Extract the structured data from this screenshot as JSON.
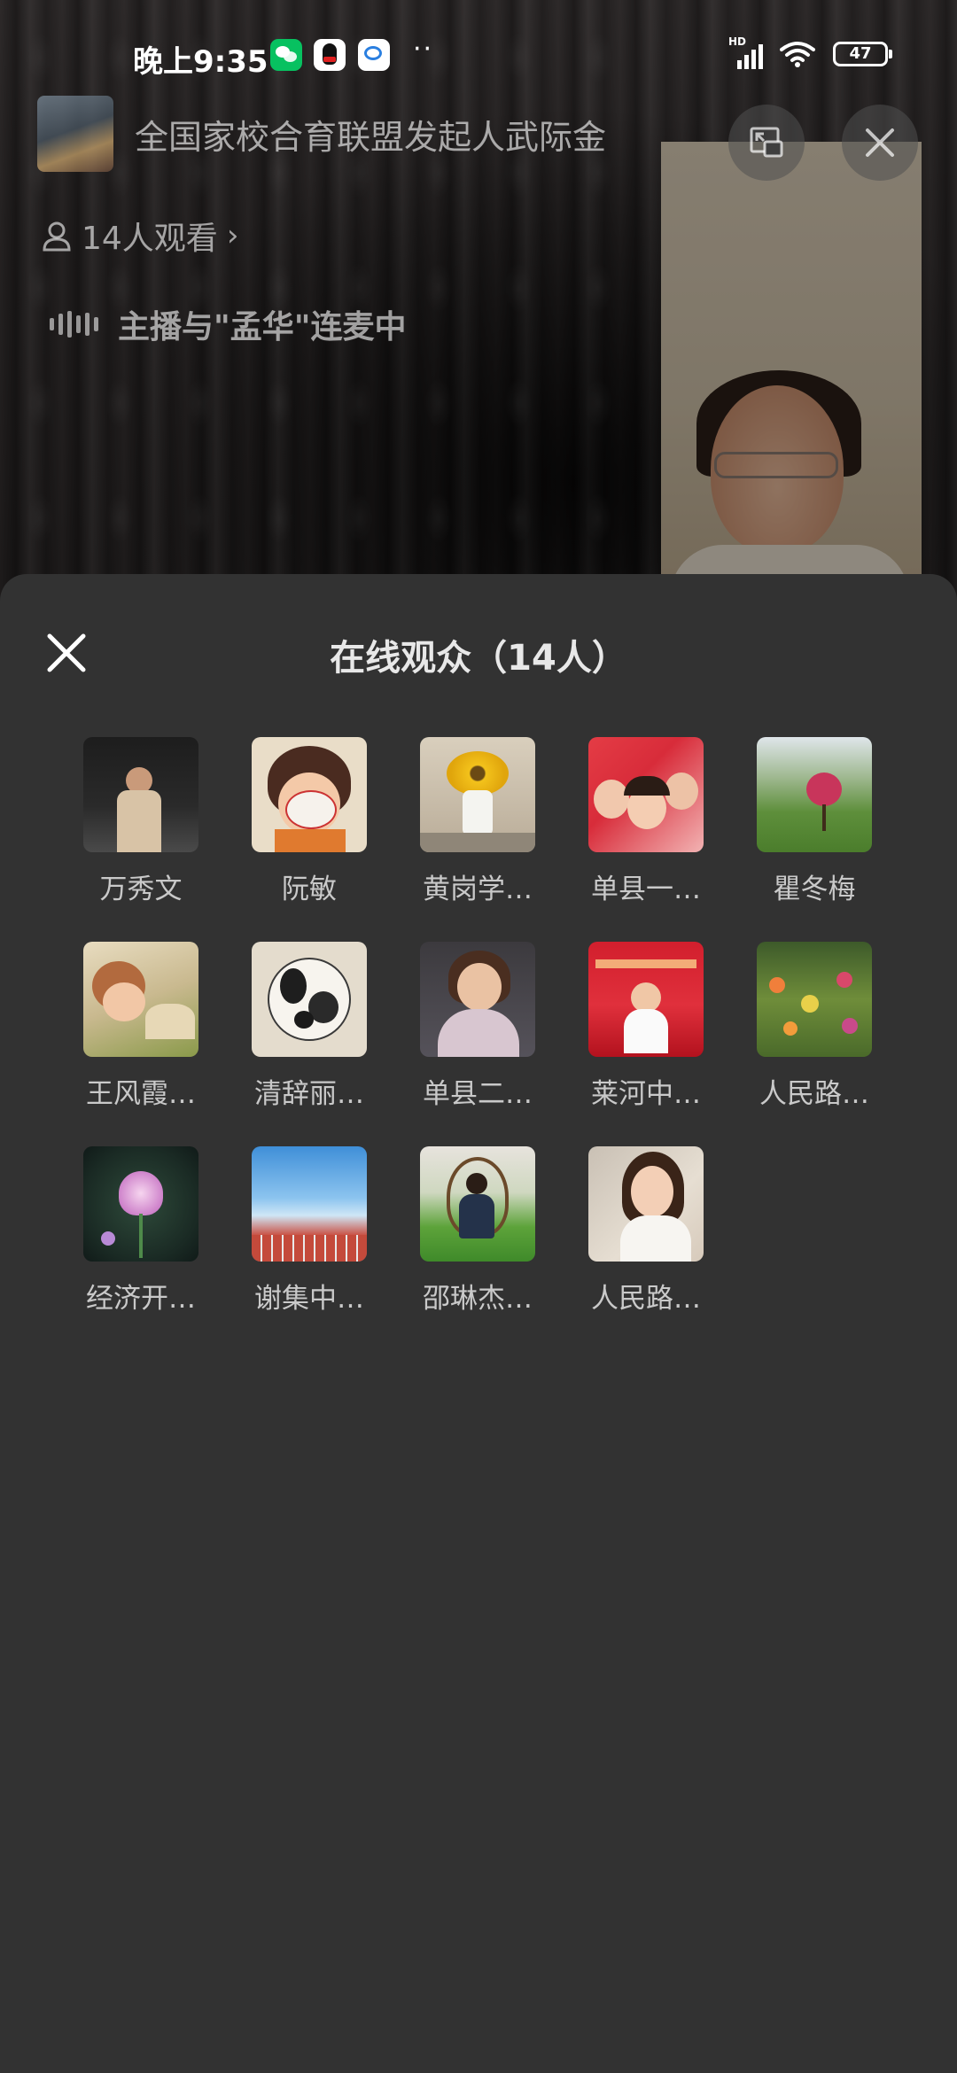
{
  "status_bar": {
    "time": "晚上9:35",
    "network": "HD",
    "battery": "47",
    "icons": [
      "wechat-icon",
      "qq-icon",
      "chat-icon",
      "more-dots-icon",
      "signal-icon",
      "wifi-icon",
      "battery-icon"
    ]
  },
  "live": {
    "title": "全国家校合育联盟发起人武际金",
    "viewers": "14人观看",
    "mic_status": "主播与\"孟华\"连麦中"
  },
  "audience_sheet": {
    "title": "在线观众（14人）",
    "members": [
      {
        "name": "万秀文"
      },
      {
        "name": "阮敏"
      },
      {
        "name": "黄岗学…"
      },
      {
        "name": "单县一…"
      },
      {
        "name": "瞿冬梅"
      },
      {
        "name": "王风霞…"
      },
      {
        "name": "清辞丽…"
      },
      {
        "name": "单县二…"
      },
      {
        "name": "莱河中…"
      },
      {
        "name": "人民路…"
      },
      {
        "name": "经济开…"
      },
      {
        "name": "谢集中…"
      },
      {
        "name": "邵琳杰…"
      },
      {
        "name": "人民路…"
      }
    ]
  },
  "colors": {
    "sheet_bg": "#323232",
    "text_secondary": "#c9c9c9"
  }
}
